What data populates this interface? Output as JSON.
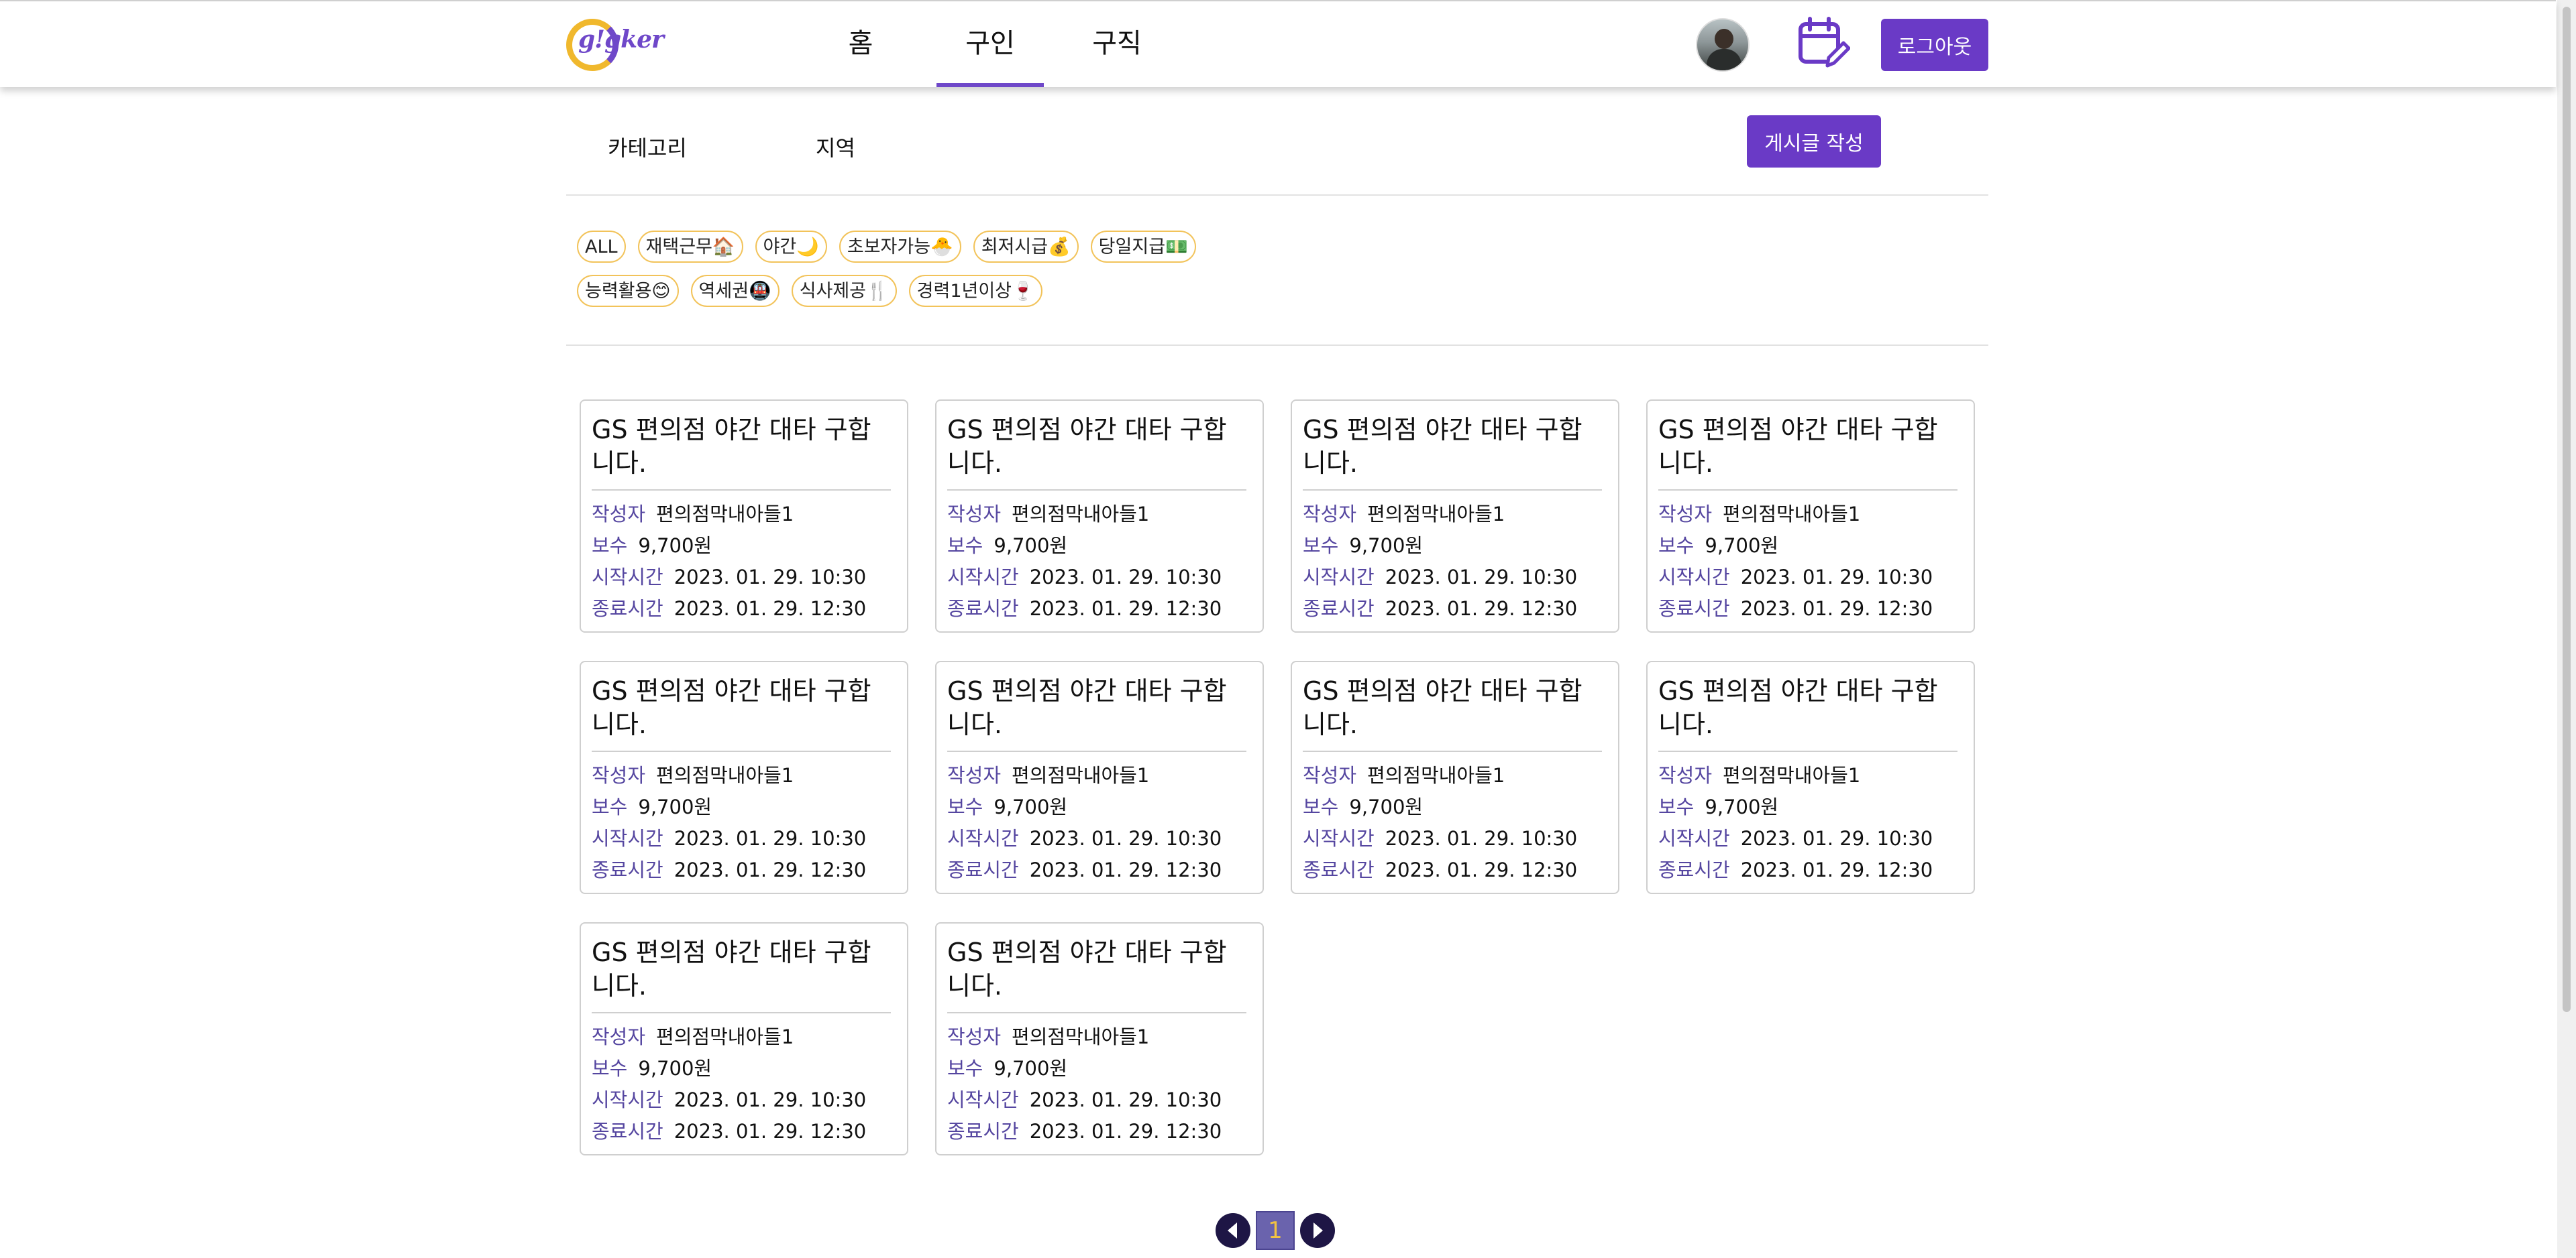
{
  "header": {
    "logo_text": "g!gker",
    "nav": [
      {
        "label": "홈",
        "active": false
      },
      {
        "label": "구인",
        "active": true
      },
      {
        "label": "구직",
        "active": false
      }
    ],
    "logout_label": "로그아웃",
    "accent_color": "#6a3ac6"
  },
  "filters": {
    "category_label": "카테고리",
    "region_label": "지역",
    "write_label": "게시글 작성"
  },
  "tags": [
    [
      "ALL",
      "재택근무🏠",
      "야간🌙",
      "초보자가능🐣",
      "최저시급💰",
      "당일지급💵"
    ],
    [
      "능력활용😊",
      "역세권🚇",
      "식사제공🍴",
      "경력1년이상🍷"
    ]
  ],
  "card_fields": {
    "author": "작성자",
    "pay": "보수",
    "start": "시작시간",
    "end": "종료시간"
  },
  "posts": [
    {
      "title": "GS 편의점 야간 대타 구합니다.",
      "author": "편의점막내아들1",
      "pay": "9,700원",
      "start": "2023. 01. 29. 10:30",
      "end": "2023. 01. 29. 12:30"
    },
    {
      "title": "GS 편의점 야간 대타 구합니다.",
      "author": "편의점막내아들1",
      "pay": "9,700원",
      "start": "2023. 01. 29. 10:30",
      "end": "2023. 01. 29. 12:30"
    },
    {
      "title": "GS 편의점 야간 대타 구합니다.",
      "author": "편의점막내아들1",
      "pay": "9,700원",
      "start": "2023. 01. 29. 10:30",
      "end": "2023. 01. 29. 12:30"
    },
    {
      "title": "GS 편의점 야간 대타 구합니다.",
      "author": "편의점막내아들1",
      "pay": "9,700원",
      "start": "2023. 01. 29. 10:30",
      "end": "2023. 01. 29. 12:30"
    },
    {
      "title": "GS 편의점 야간 대타 구합니다.",
      "author": "편의점막내아들1",
      "pay": "9,700원",
      "start": "2023. 01. 29. 10:30",
      "end": "2023. 01. 29. 12:30"
    },
    {
      "title": "GS 편의점 야간 대타 구합니다.",
      "author": "편의점막내아들1",
      "pay": "9,700원",
      "start": "2023. 01. 29. 10:30",
      "end": "2023. 01. 29. 12:30"
    },
    {
      "title": "GS 편의점 야간 대타 구합니다.",
      "author": "편의점막내아들1",
      "pay": "9,700원",
      "start": "2023. 01. 29. 10:30",
      "end": "2023. 01. 29. 12:30"
    },
    {
      "title": "GS 편의점 야간 대타 구합니다.",
      "author": "편의점막내아들1",
      "pay": "9,700원",
      "start": "2023. 01. 29. 10:30",
      "end": "2023. 01. 29. 12:30"
    },
    {
      "title": "GS 편의점 야간 대타 구합니다.",
      "author": "편의점막내아들1",
      "pay": "9,700원",
      "start": "2023. 01. 29. 10:30",
      "end": "2023. 01. 29. 12:30"
    },
    {
      "title": "GS 편의점 야간 대타 구합니다.",
      "author": "편의점막내아들1",
      "pay": "9,700원",
      "start": "2023. 01. 29. 10:30",
      "end": "2023. 01. 29. 12:30"
    }
  ],
  "pagination": {
    "current_page": "1",
    "prev_icon": "chevron-left-icon",
    "next_icon": "chevron-right-icon"
  }
}
